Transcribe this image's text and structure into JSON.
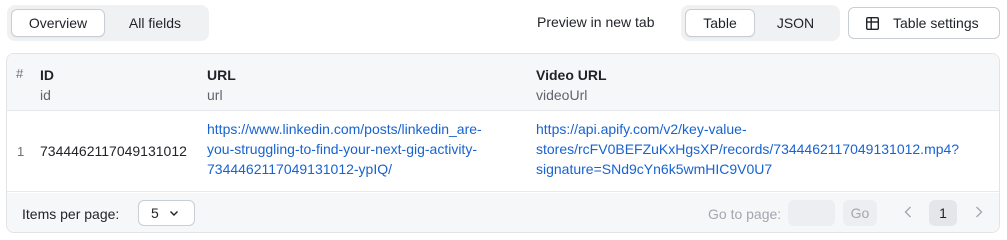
{
  "view_tabs": [
    {
      "label": "Overview",
      "active": true
    },
    {
      "label": "All fields",
      "active": false
    }
  ],
  "preview_link": "Preview in new tab",
  "format_tabs": [
    {
      "label": "Table",
      "active": true
    },
    {
      "label": "JSON",
      "active": false
    }
  ],
  "table_settings": {
    "label": "Table settings",
    "icon": "table-settings-icon"
  },
  "table": {
    "index_header": "#",
    "columns": [
      {
        "title": "ID",
        "field": "id"
      },
      {
        "title": "URL",
        "field": "url"
      },
      {
        "title": "Video URL",
        "field": "videoUrl"
      }
    ],
    "rows": [
      {
        "index": "1",
        "id": "7344462117049131012",
        "url_lines": [
          "https://www.linkedin.com/posts/linkedin_are-",
          "you-struggling-to-find-your-next-gig-activity-",
          "7344462117049131012-ypIQ/"
        ],
        "video_lines": [
          "https://api.apify.com/v2/key-value-",
          "stores/rcFV0BEFZuKxHgsXP/records/7344462117049131012.mp4?",
          "signature=SNd9cYn6k5wmHIC9V0U7"
        ]
      }
    ]
  },
  "footer": {
    "items_per_page_label": "Items per page:",
    "items_per_page_value": "5",
    "go_to_page_label": "Go to page:",
    "go_to_page_value": "",
    "go_label": "Go",
    "current_page": "1"
  },
  "colors": {
    "link": "#1763d1",
    "header_bg": "#f6f7f8",
    "segment_bg": "#f0f1f3"
  }
}
